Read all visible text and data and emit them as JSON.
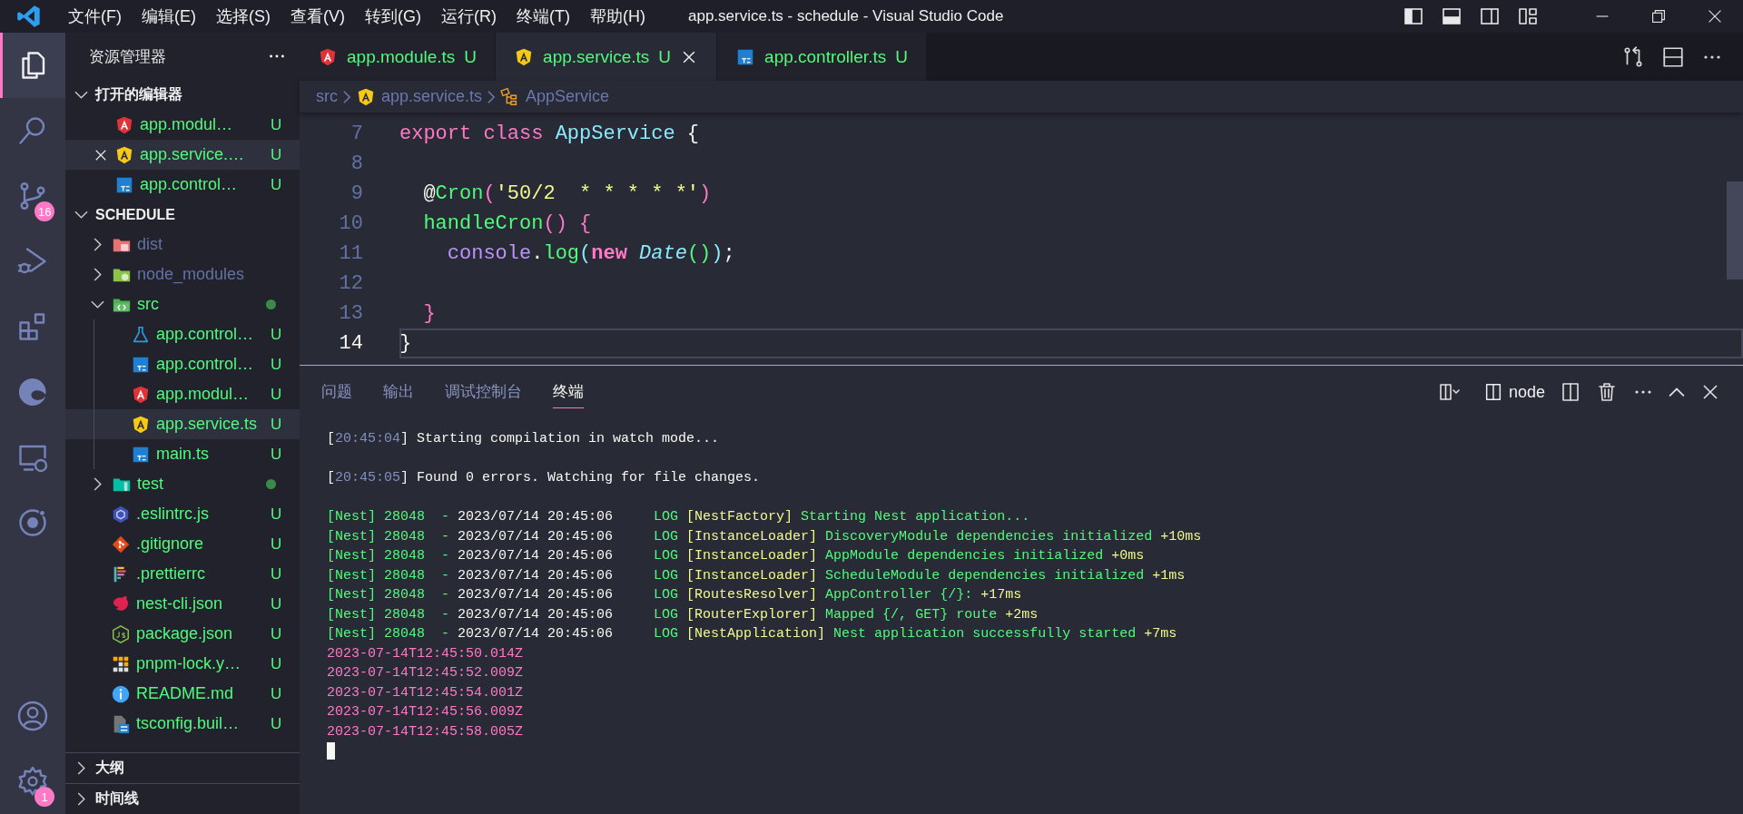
{
  "title_bar": {
    "menus": [
      "文件(F)",
      "编辑(E)",
      "选择(S)",
      "查看(V)",
      "转到(G)",
      "运行(R)",
      "终端(T)",
      "帮助(H)"
    ],
    "title": "app.service.ts - schedule - Visual Studio Code",
    "layout_toggles": [
      {
        "kind": "primary-sidebar",
        "on": true
      },
      {
        "kind": "panel",
        "on": true
      },
      {
        "kind": "secondary-sidebar",
        "on": false
      }
    ]
  },
  "activity_bar": {
    "items": [
      {
        "kind": "explorer",
        "selected": true
      },
      {
        "kind": "search",
        "selected": false
      },
      {
        "kind": "source-control",
        "selected": false,
        "badge": "16"
      },
      {
        "kind": "run-debug",
        "selected": false
      },
      {
        "kind": "extensions",
        "selected": false
      },
      {
        "kind": "browser",
        "selected": false
      },
      {
        "kind": "remote",
        "selected": false
      },
      {
        "kind": "ring",
        "selected": false
      }
    ],
    "bottom": [
      {
        "kind": "account",
        "selected": false
      },
      {
        "kind": "settings",
        "selected": false,
        "badge": "1"
      }
    ]
  },
  "sidebar": {
    "title": "资源管理器",
    "sections": [
      {
        "kind": "open-editors",
        "title": "打开的编辑器",
        "expanded": true,
        "items": [
          {
            "name": "app.modul…",
            "kind": "module",
            "status": "U",
            "selected": false
          },
          {
            "name": "app.service.…",
            "kind": "service",
            "status": "U",
            "selected": true
          },
          {
            "name": "app.control…",
            "kind": "ts",
            "status": "U",
            "selected": false
          }
        ]
      },
      {
        "kind": "tree",
        "title": "SCHEDULE",
        "expanded": true,
        "items": [
          {
            "name": "dist",
            "kind": "folder-dist",
            "expanded": false,
            "ignored": true,
            "dot": false
          },
          {
            "name": "node_modules",
            "kind": "folder-node",
            "expanded": false,
            "ignored": true,
            "dot": false
          },
          {
            "name": "src",
            "kind": "folder-src",
            "expanded": true,
            "ignored": false,
            "dot": true,
            "children": [
              {
                "name": "app.control…",
                "kind": "spec",
                "status": "U",
                "selected": false
              },
              {
                "name": "app.control…",
                "kind": "ts",
                "status": "U",
                "selected": false
              },
              {
                "name": "app.modul…",
                "kind": "module",
                "status": "U",
                "selected": false
              },
              {
                "name": "app.service.ts",
                "kind": "service",
                "status": "U",
                "selected": true
              },
              {
                "name": "main.ts",
                "kind": "ts",
                "status": "U",
                "selected": false
              }
            ]
          },
          {
            "name": "test",
            "kind": "folder-test",
            "expanded": false,
            "ignored": false,
            "dot": true
          },
          {
            "name": ".eslintrc.js",
            "kind": "eslint",
            "status": "U",
            "selected": false
          },
          {
            "name": ".gitignore",
            "kind": "git",
            "status": "U",
            "selected": false
          },
          {
            "name": ".prettierrc",
            "kind": "prettier",
            "status": "U",
            "selected": false
          },
          {
            "name": "nest-cli.json",
            "kind": "nest",
            "status": "U",
            "selected": false
          },
          {
            "name": "package.json",
            "kind": "js",
            "status": "U",
            "selected": false
          },
          {
            "name": "pnpm-lock.y…",
            "kind": "pnpm",
            "status": "U",
            "selected": false
          },
          {
            "name": "README.md",
            "kind": "info",
            "status": "U",
            "selected": false
          },
          {
            "name": "tsconfig.buil…",
            "kind": "tsconfig",
            "status": "U",
            "selected": false
          }
        ]
      },
      {
        "kind": "collapsed",
        "title": "大纲",
        "expanded": false
      },
      {
        "kind": "collapsed",
        "title": "时间线",
        "expanded": false
      }
    ]
  },
  "editor": {
    "tabs": [
      {
        "name": "app.module.ts",
        "kind": "module",
        "status": "U",
        "selected": false
      },
      {
        "name": "app.service.ts",
        "kind": "service",
        "status": "U",
        "selected": true
      },
      {
        "name": "app.controller.ts",
        "kind": "ts",
        "status": "U",
        "selected": false
      }
    ],
    "breadcrumbs": [
      {
        "text": "src",
        "kind": "folder"
      },
      {
        "text": "app.service.ts",
        "kind": "service"
      },
      {
        "text": "AppService",
        "kind": "class"
      }
    ],
    "lines": [
      {
        "number": "7",
        "active": false,
        "tokens": [
          {
            "t": "export class",
            "kind": "keyword"
          },
          {
            "t": " AppService",
            "kind": "type"
          },
          {
            "t": " {",
            "kind": "punct"
          }
        ]
      },
      {
        "number": "8",
        "active": false
      },
      {
        "number": "9",
        "active": false,
        "tokens": [
          {
            "t": "  @",
            "kind": "punct"
          },
          {
            "t": "Cron",
            "kind": "func"
          },
          {
            "t": "(",
            "kind": "bracket-pink"
          },
          {
            "t": "'50/2  * * * * *'",
            "kind": "string"
          },
          {
            "t": ")",
            "kind": "bracket-pink"
          }
        ]
      },
      {
        "number": "10",
        "active": false,
        "tokens": [
          {
            "t": "  handleCron",
            "kind": "func"
          },
          {
            "t": "() {",
            "kind": "bracket-pink"
          }
        ]
      },
      {
        "number": "11",
        "active": false,
        "tokens": [
          {
            "t": "    console",
            "kind": "variable"
          },
          {
            "t": ".",
            "kind": "punct"
          },
          {
            "t": "log",
            "kind": "func"
          },
          {
            "t": "(",
            "kind": "bracket-cyan"
          },
          {
            "t": "new ",
            "kind": "keyword-bold"
          },
          {
            "t": "Date",
            "kind": "type-italic"
          },
          {
            "t": "()",
            "kind": "bracket-green"
          },
          {
            "t": ")",
            "kind": "bracket-cyan"
          },
          {
            "t": ";",
            "kind": "punct"
          }
        ]
      },
      {
        "number": "12",
        "active": false
      },
      {
        "number": "13",
        "active": false,
        "tokens": [
          {
            "t": "  }",
            "kind": "bracket-pink"
          }
        ]
      },
      {
        "number": "14",
        "active": true,
        "tokens": [
          {
            "t": "}",
            "kind": "punct"
          }
        ]
      }
    ]
  },
  "panel": {
    "tabs": [
      {
        "label": "问题",
        "selected": false
      },
      {
        "label": "输出",
        "selected": false
      },
      {
        "label": "调试控制台",
        "selected": false
      },
      {
        "label": "终端",
        "selected": true
      }
    ],
    "terminal_name": "node",
    "lines": [
      {
        "kind": "output",
        "segments": [
          {
            "t": "[",
            "kind": "text"
          },
          {
            "t": "20:45:04",
            "kind": "dim"
          },
          {
            "t": "] Starting compilation in watch mode...",
            "kind": "text"
          }
        ]
      },
      {
        "kind": "blank"
      },
      {
        "kind": "output",
        "segments": [
          {
            "t": "[",
            "kind": "text"
          },
          {
            "t": "20:45:05",
            "kind": "dim"
          },
          {
            "t": "] Found 0 errors. Watching for file changes.",
            "kind": "text"
          }
        ]
      },
      {
        "kind": "blank"
      },
      {
        "kind": "output",
        "segments": [
          {
            "t": "[Nest] 28048  - ",
            "kind": "green"
          },
          {
            "t": "2023/07/14 20:45:06",
            "kind": "text"
          },
          {
            "t": "     LOG ",
            "kind": "green"
          },
          {
            "t": "[NestFactory]",
            "kind": "yellow"
          },
          {
            "t": " Starting Nest application...",
            "kind": "green"
          }
        ]
      },
      {
        "kind": "output",
        "segments": [
          {
            "t": "[Nest] 28048  - ",
            "kind": "green"
          },
          {
            "t": "2023/07/14 20:45:06",
            "kind": "text"
          },
          {
            "t": "     LOG ",
            "kind": "green"
          },
          {
            "t": "[InstanceLoader]",
            "kind": "yellow"
          },
          {
            "t": " DiscoveryModule dependencies initialized ",
            "kind": "green"
          },
          {
            "t": "+10ms",
            "kind": "yellow"
          }
        ]
      },
      {
        "kind": "output",
        "segments": [
          {
            "t": "[Nest] 28048  - ",
            "kind": "green"
          },
          {
            "t": "2023/07/14 20:45:06",
            "kind": "text"
          },
          {
            "t": "     LOG ",
            "kind": "green"
          },
          {
            "t": "[InstanceLoader]",
            "kind": "yellow"
          },
          {
            "t": " AppModule dependencies initialized ",
            "kind": "green"
          },
          {
            "t": "+0ms",
            "kind": "yellow"
          }
        ]
      },
      {
        "kind": "output",
        "segments": [
          {
            "t": "[Nest] 28048  - ",
            "kind": "green"
          },
          {
            "t": "2023/07/14 20:45:06",
            "kind": "text"
          },
          {
            "t": "     LOG ",
            "kind": "green"
          },
          {
            "t": "[InstanceLoader]",
            "kind": "yellow"
          },
          {
            "t": " ScheduleModule dependencies initialized ",
            "kind": "green"
          },
          {
            "t": "+1ms",
            "kind": "yellow"
          }
        ]
      },
      {
        "kind": "output",
        "segments": [
          {
            "t": "[Nest] 28048  - ",
            "kind": "green"
          },
          {
            "t": "2023/07/14 20:45:06",
            "kind": "text"
          },
          {
            "t": "     LOG ",
            "kind": "green"
          },
          {
            "t": "[RoutesResolver]",
            "kind": "yellow"
          },
          {
            "t": " AppController {/}: ",
            "kind": "green"
          },
          {
            "t": "+17ms",
            "kind": "yellow"
          }
        ]
      },
      {
        "kind": "output",
        "segments": [
          {
            "t": "[Nest] 28048  - ",
            "kind": "green"
          },
          {
            "t": "2023/07/14 20:45:06",
            "kind": "text"
          },
          {
            "t": "     LOG ",
            "kind": "green"
          },
          {
            "t": "[RouterExplorer]",
            "kind": "yellow"
          },
          {
            "t": " Mapped {/, GET} route ",
            "kind": "green"
          },
          {
            "t": "+2ms",
            "kind": "yellow"
          }
        ]
      },
      {
        "kind": "output",
        "segments": [
          {
            "t": "[Nest] 28048  - ",
            "kind": "green"
          },
          {
            "t": "2023/07/14 20:45:06",
            "kind": "text"
          },
          {
            "t": "     LOG ",
            "kind": "green"
          },
          {
            "t": "[NestApplication]",
            "kind": "yellow"
          },
          {
            "t": " Nest application successfully started ",
            "kind": "green"
          },
          {
            "t": "+7ms",
            "kind": "yellow"
          }
        ]
      },
      {
        "kind": "output",
        "segments": [
          {
            "t": "2023-07-14T12:45:50.014Z",
            "kind": "pink"
          }
        ]
      },
      {
        "kind": "output",
        "segments": [
          {
            "t": "2023-07-14T12:45:52.009Z",
            "kind": "pink"
          }
        ]
      },
      {
        "kind": "output",
        "segments": [
          {
            "t": "2023-07-14T12:45:54.001Z",
            "kind": "pink"
          }
        ]
      },
      {
        "kind": "output",
        "segments": [
          {
            "t": "2023-07-14T12:45:56.009Z",
            "kind": "pink"
          }
        ]
      },
      {
        "kind": "output",
        "segments": [
          {
            "t": "2023-07-14T12:45:58.005Z",
            "kind": "pink"
          }
        ]
      },
      {
        "kind": "cursor"
      }
    ]
  }
}
